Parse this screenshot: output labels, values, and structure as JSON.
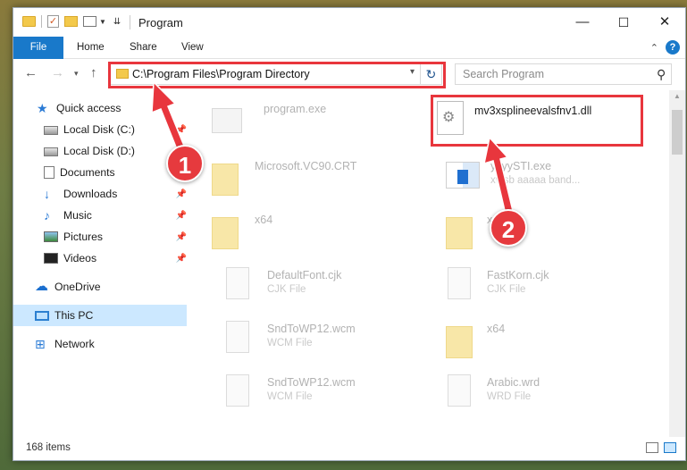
{
  "window": {
    "title": "Program",
    "controls": {
      "minimize": "—",
      "maximize": "☐",
      "close": "✕"
    }
  },
  "ribbon": {
    "tabs": [
      "File",
      "Home",
      "Share",
      "View"
    ]
  },
  "address_bar": {
    "path": "C:\\Program Files\\Program Directory"
  },
  "search": {
    "placeholder": "Search Program"
  },
  "sidebar": {
    "items": [
      {
        "label": "Quick access",
        "icon": "star-icon"
      },
      {
        "label": "Local Disk (C:)",
        "icon": "disk-icon",
        "pinned": true
      },
      {
        "label": "Local Disk (D:)",
        "icon": "disk-icon"
      },
      {
        "label": "Documents",
        "icon": "documents-icon"
      },
      {
        "label": "Downloads",
        "icon": "download-icon",
        "pinned": true
      },
      {
        "label": "Music",
        "icon": "music-icon",
        "pinned": true
      },
      {
        "label": "Pictures",
        "icon": "pictures-icon",
        "pinned": true
      },
      {
        "label": "Videos",
        "icon": "videos-icon",
        "pinned": true
      },
      {
        "label": "OneDrive",
        "icon": "cloud-icon"
      },
      {
        "label": "This PC",
        "icon": "computer-icon",
        "selected": true
      },
      {
        "label": "Network",
        "icon": "network-icon"
      }
    ]
  },
  "files": [
    {
      "name": "program.exe",
      "desc": ""
    },
    {
      "name": "mv3xsplineevalsfnv1.dll",
      "desc": ""
    },
    {
      "name": "Microsoft.VC90.CRT",
      "desc": ""
    },
    {
      "name": "ykyySTI.exe",
      "desc": "xv sb aaaaa band..."
    },
    {
      "name": "x64",
      "desc": ""
    },
    {
      "name": "x64",
      "desc": ""
    },
    {
      "name": "DefaultFont.cjk",
      "desc": "CJK File"
    },
    {
      "name": "FastKorn.cjk",
      "desc": "CJK File"
    },
    {
      "name": "SndToWP12.wcm",
      "desc": "WCM File"
    },
    {
      "name": "x64",
      "desc": ""
    },
    {
      "name": "SndToWP12.wcm",
      "desc": "WCM File"
    },
    {
      "name": "Arabic.wrd",
      "desc": "WRD File"
    }
  ],
  "status_bar": {
    "item_count": "168 items"
  },
  "annotations": {
    "marker1": "1",
    "marker2": "2",
    "color": "#e8363d"
  }
}
